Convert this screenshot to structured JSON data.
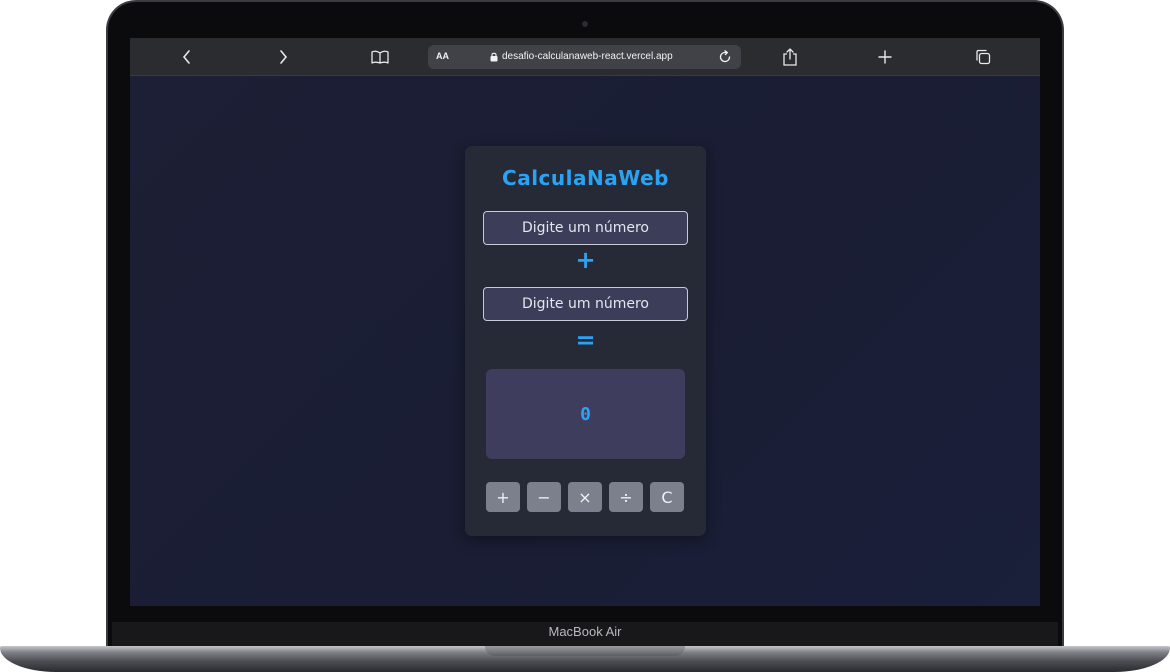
{
  "device": {
    "model_label": "MacBook Air"
  },
  "browser": {
    "address_prefix": "AA",
    "url": "desafio-calculanaweb-react.vercel.app",
    "icons": {
      "back": "chevron-left-icon",
      "forward": "chevron-right-icon",
      "bookmarks": "book-icon",
      "lock": "lock-icon",
      "reload": "reload-icon",
      "share": "share-icon",
      "new_tab": "plus-icon",
      "tabs": "tabs-icon"
    }
  },
  "app": {
    "title": "CalculaNaWeb",
    "first_input": {
      "value": "",
      "placeholder": "Digite um número"
    },
    "second_input": {
      "value": "",
      "placeholder": "Digite um número"
    },
    "current_operator": "+",
    "equals_symbol": "=",
    "result": "0",
    "buttons": [
      {
        "label": "+"
      },
      {
        "label": "−"
      },
      {
        "label": "×"
      },
      {
        "label": "÷"
      },
      {
        "label": "C"
      }
    ],
    "colors": {
      "accent": "#2ba3f5",
      "card": "#262a36",
      "input_bg": "#3b3d59",
      "result_bg": "#3f3d5d",
      "button_bg": "#7c808d",
      "page_bg": "#1c1f35"
    }
  }
}
